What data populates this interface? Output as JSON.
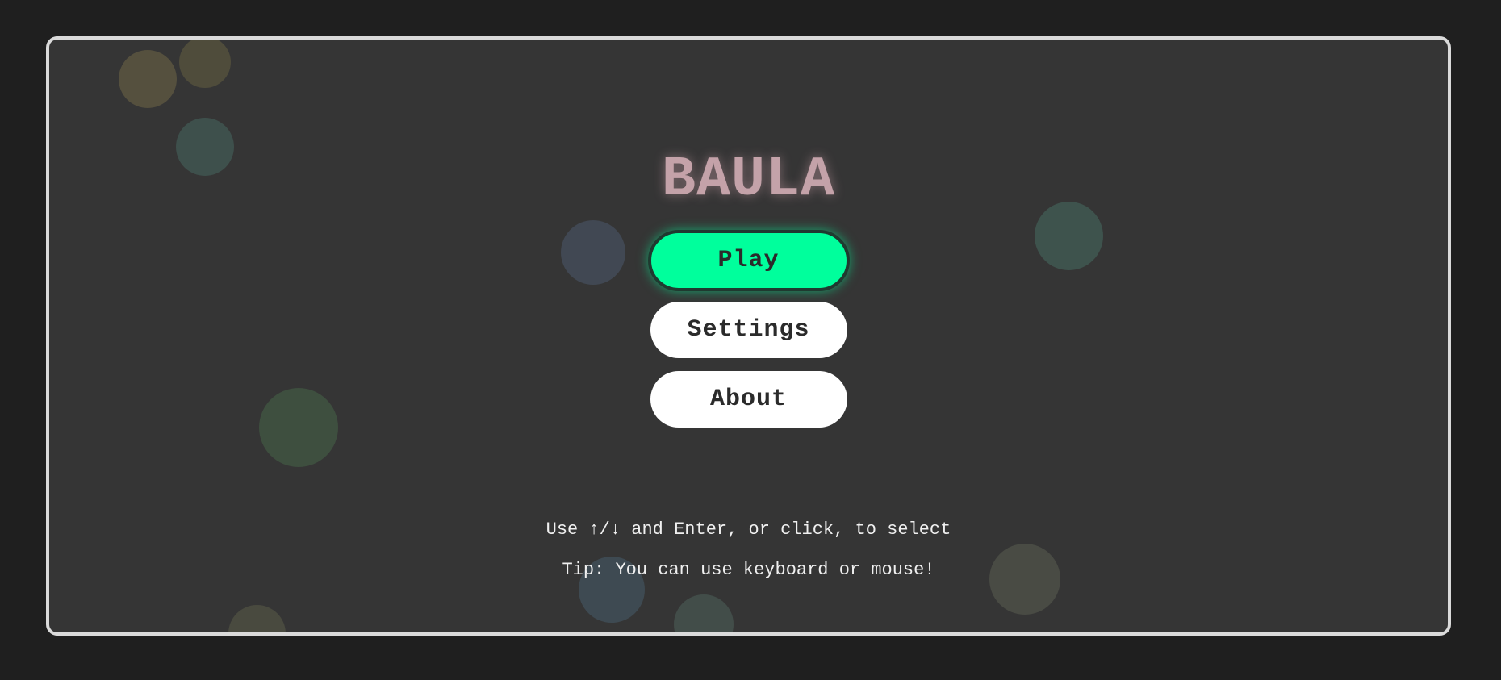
{
  "game": {
    "title": "BAULA"
  },
  "menu": {
    "items": [
      {
        "label": "Play",
        "selected": true
      },
      {
        "label": "Settings",
        "selected": false
      },
      {
        "label": "About",
        "selected": false
      }
    ]
  },
  "hints": {
    "controls": "Use ↑/↓ and Enter, or click, to select",
    "tip": "Tip: You can use keyboard or mouse!"
  },
  "colors": {
    "background": "#1f1f1f",
    "panel": "#353535",
    "panel_border": "#dadada",
    "title": "#c4a2a9",
    "selected_button": "#00ff9c",
    "button": "#ffffff",
    "button_text": "#2b2b2b"
  }
}
